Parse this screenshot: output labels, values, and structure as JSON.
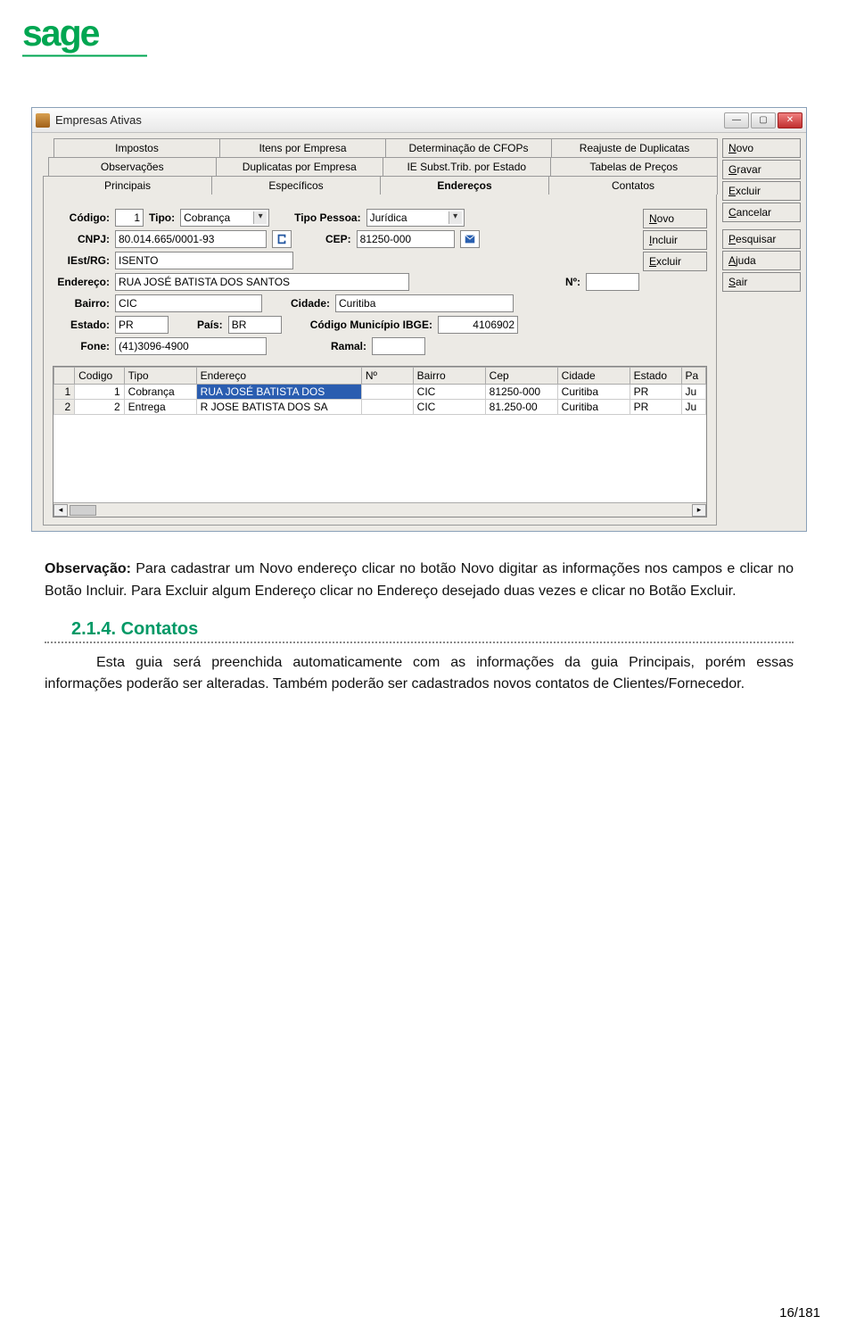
{
  "logo": {
    "text": "sage"
  },
  "window": {
    "title": "Empresas Ativas",
    "sidebar": {
      "novo": "Novo",
      "gravar": "Gravar",
      "excluir": "Excluir",
      "cancelar": "Cancelar",
      "pesquisar": "Pesquisar",
      "ajuda": "Ajuda",
      "sair": "Sair"
    },
    "tabs": {
      "row1": [
        "Impostos",
        "Itens por Empresa",
        "Determinação de CFOPs",
        "Reajuste de Duplicatas"
      ],
      "row2": [
        "Observações",
        "Duplicatas por Empresa",
        "IE Subst.Trib. por Estado",
        "Tabelas de Preços"
      ],
      "row3": [
        "Principais",
        "Específicos",
        "Endereços",
        "Contatos"
      ],
      "active": "Endereços"
    },
    "form": {
      "labels": {
        "codigo": "Código:",
        "tipo": "Tipo:",
        "tipo_pessoa": "Tipo Pessoa:",
        "cnpj": "CNPJ:",
        "cep": "CEP:",
        "iest": "IEst/RG:",
        "endereco": "Endereço:",
        "numero": "Nº:",
        "bairro": "Bairro:",
        "cidade": "Cidade:",
        "estado": "Estado:",
        "pais": "País:",
        "cod_ibge": "Código Município IBGE:",
        "fone": "Fone:",
        "ramal": "Ramal:"
      },
      "values": {
        "codigo": "1",
        "tipo": "Cobrança",
        "tipo_pessoa": "Jurídica",
        "cnpj": "80.014.665/0001-93",
        "cep": "81250-000",
        "iest": "ISENTO",
        "endereco": "RUA JOSÉ BATISTA DOS SANTOS",
        "numero": "",
        "bairro": "CIC",
        "cidade": "Curitiba",
        "estado": "PR",
        "pais": "BR",
        "cod_ibge": "4106902",
        "fone": "(41)3096-4900",
        "ramal": ""
      },
      "inner_buttons": {
        "novo": "Novo",
        "incluir": "Incluir",
        "excluir": "Excluir"
      }
    },
    "grid": {
      "headers": [
        "",
        "Codigo",
        "Tipo",
        "Endereço",
        "Nº",
        "Bairro",
        "Cep",
        "Cidade",
        "Estado",
        "Pa"
      ],
      "rows": [
        {
          "n": "1",
          "codigo": "1",
          "tipo": "Cobrança",
          "endereco": "RUA JOSÉ  BATISTA DOS",
          "num": "",
          "bairro": "CIC",
          "cep": "81250-000",
          "cidade": "Curitiba",
          "estado": "PR",
          "pa": "Ju",
          "selected_col": "endereco"
        },
        {
          "n": "2",
          "codigo": "2",
          "tipo": "Entrega",
          "endereco": "R JOSE BATISTA DOS SA",
          "num": "",
          "bairro": "CIC",
          "cep": "81.250-00",
          "cidade": "Curitiba",
          "estado": "PR",
          "pa": "Ju"
        }
      ]
    }
  },
  "text": {
    "p1_bold": "Observação:",
    "p1": " Para cadastrar um Novo endereço clicar no botão Novo digitar as informações nos campos e clicar no Botão Incluir. Para Excluir algum Endereço clicar no Endereço desejado duas vezes e clicar no Botão Excluir.",
    "section_num": "2.1.4.",
    "section_title": "Contatos",
    "p2": "Esta guia será preenchida automaticamente com as informações da guia Principais, porém essas informações poderão ser alteradas. Também poderão ser cadastrados novos contatos de Clientes/Fornecedor."
  },
  "page_number": "16/181"
}
